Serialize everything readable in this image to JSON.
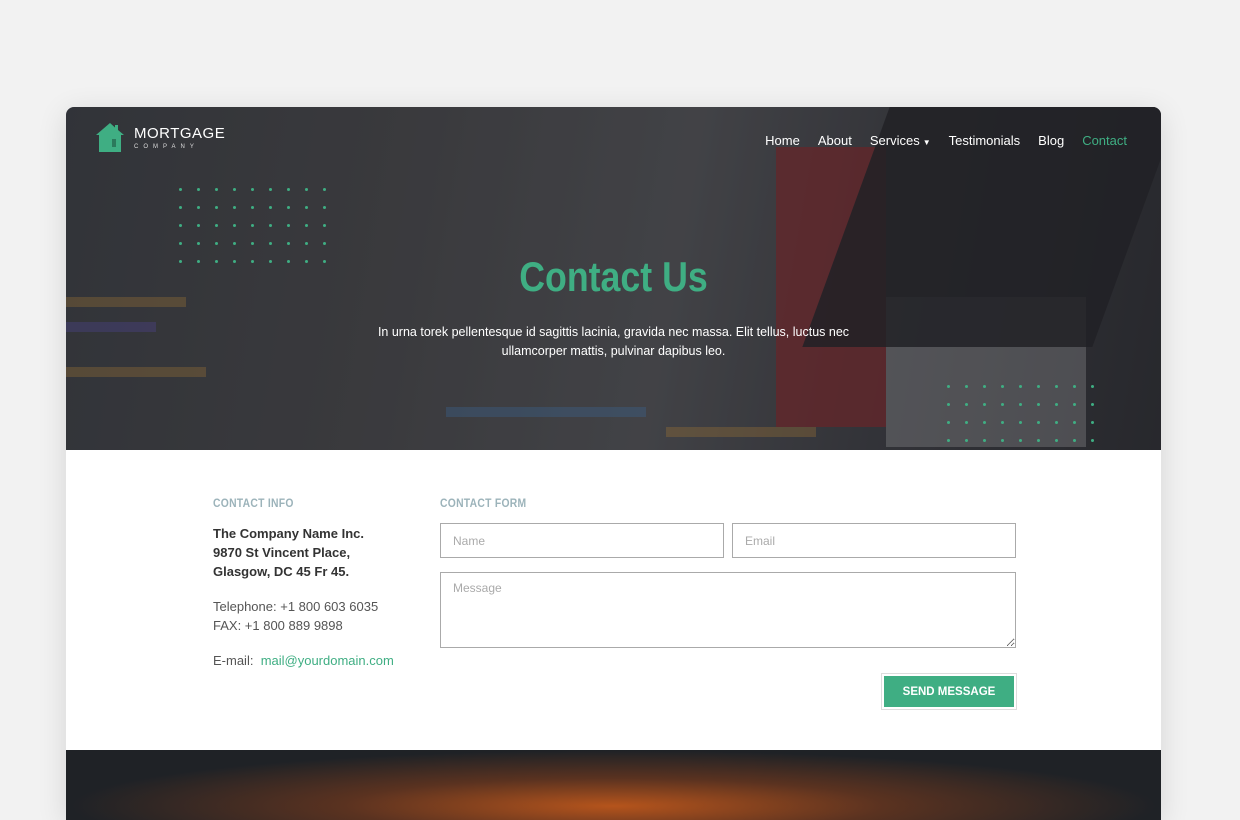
{
  "brand": {
    "name": "MORTGAGE",
    "tagline": "COMPANY",
    "color": "#3fae83"
  },
  "nav": [
    {
      "label": "Home"
    },
    {
      "label": "About"
    },
    {
      "label": "Services",
      "has_dropdown": true
    },
    {
      "label": "Testimonials"
    },
    {
      "label": "Blog"
    },
    {
      "label": "Contact",
      "active": true
    }
  ],
  "hero": {
    "title": "Contact Us",
    "subtitle": "In urna torek pellentesque id sagittis lacinia, gravida nec massa. Elit tellus, luctus nec ullamcorper mattis, pulvinar dapibus leo."
  },
  "contact_info": {
    "heading": "CONTACT INFO",
    "address": [
      "The Company Name Inc.",
      "9870 St Vincent Place,",
      "Glasgow, DC 45 Fr 45."
    ],
    "telephone": "Telephone: +1 800 603 6035",
    "fax": "FAX: +1 800 889 9898",
    "email_label": "E-mail:",
    "email": "mail@yourdomain.com"
  },
  "contact_form": {
    "heading": "CONTACT FORM",
    "name_placeholder": "Name",
    "email_placeholder": "Email",
    "message_placeholder": "Message",
    "submit_label": "SEND MESSAGE"
  }
}
